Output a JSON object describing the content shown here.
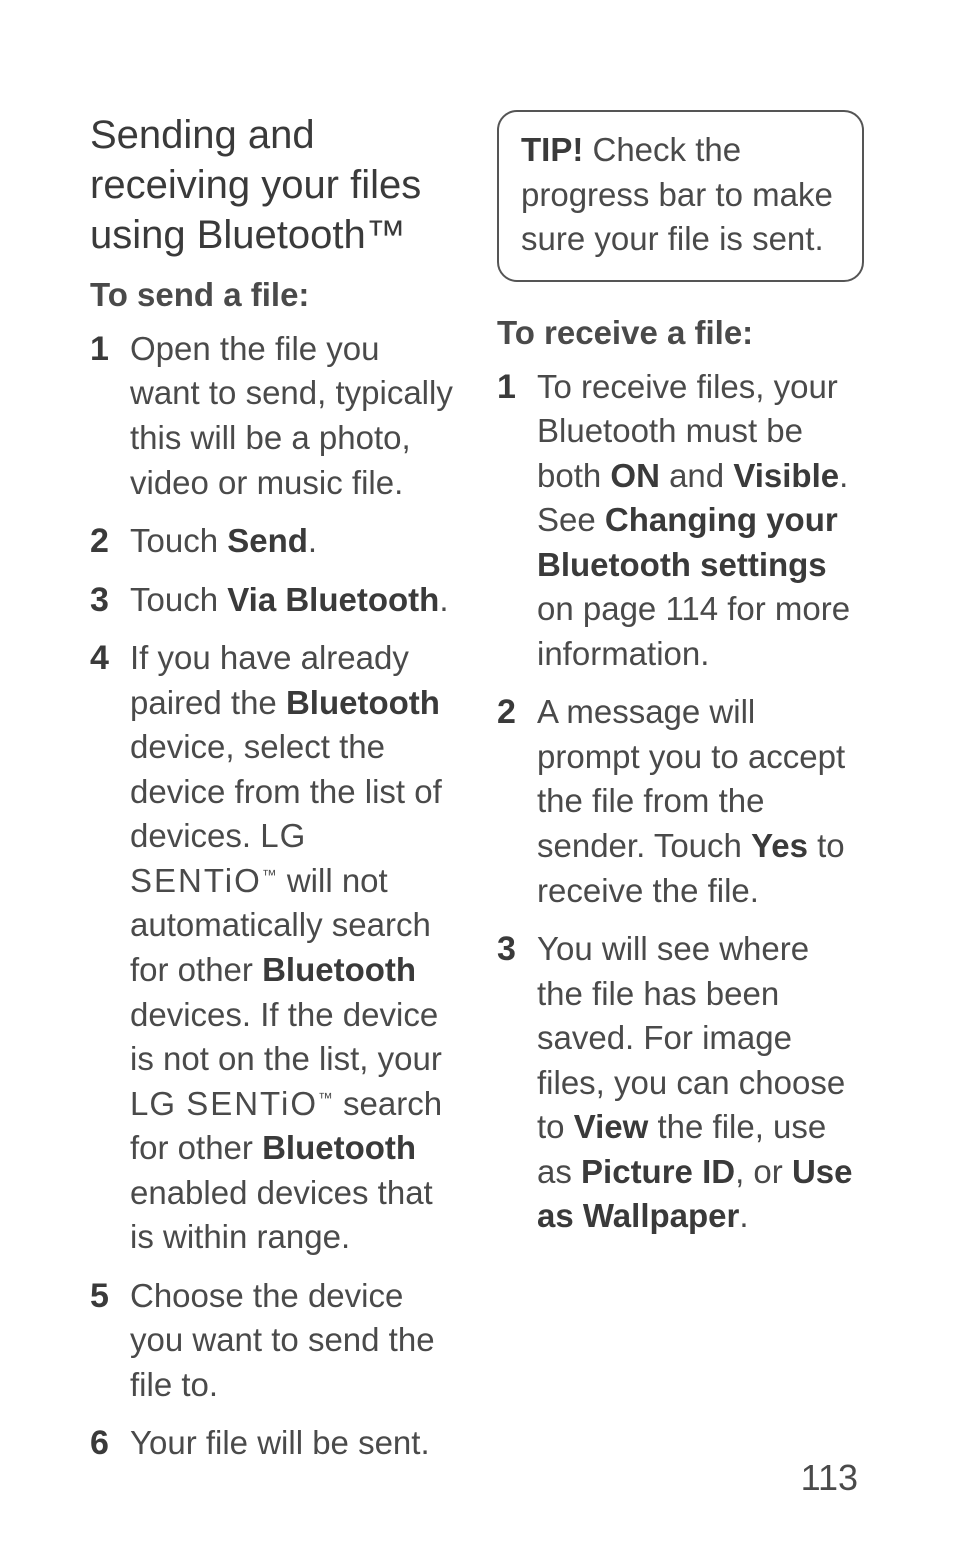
{
  "page_number": "113",
  "left": {
    "section_title": "Sending and receiving your files using Bluetooth™",
    "sub_title": "To send a file:",
    "steps": [
      {
        "text": "Open the file you want to send, typically this will be a photo, video or music file."
      },
      {
        "prefix": "Touch ",
        "bold": "Send",
        "suffix": "."
      },
      {
        "prefix": "Touch ",
        "bold": "Via Bluetooth",
        "suffix": "."
      },
      {
        "s1": "If you have already paired the ",
        "b1": "Bluetooth",
        "s2": " device, select the device from the list of devices. ",
        "brand1_pre": "",
        "brand1": "LG SENTIO",
        "brand1_tm": "™",
        "s3": " will not automatically search for other ",
        "b2": "Bluetooth",
        "s4": " devices. If the device is not on the list, your ",
        "brand2": "LG SENTIO",
        "brand2_tm": "™",
        "s5": " search for other ",
        "b3": "Bluetooth",
        "s6": " enabled devices that is within range."
      },
      {
        "text": "Choose the device you want to send the file to."
      },
      {
        "text": "Your file will be sent."
      }
    ]
  },
  "right": {
    "tip_bold": "TIP!",
    "tip_text": " Check the progress bar to make sure your file is sent.",
    "sub_title": "To receive a file:",
    "steps": [
      {
        "s1": "To receive files, your Bluetooth must be both ",
        "b1": "ON",
        "s2": " and ",
        "b2": "Visible",
        "s3": ". See ",
        "b3": "Changing your Bluetooth settings",
        "s4": " on page 114 for more information."
      },
      {
        "s1": "A message will prompt you to accept the file from the sender. Touch ",
        "b1": "Yes",
        "s2": " to receive the file."
      },
      {
        "s1": "You will see where the file has been saved. For image files, you can choose to ",
        "b1": "View",
        "s2": " the file, use as ",
        "b2": "Picture ID",
        "s3": ", or ",
        "b3": "Use as Wallpaper",
        "s4": "."
      }
    ]
  }
}
